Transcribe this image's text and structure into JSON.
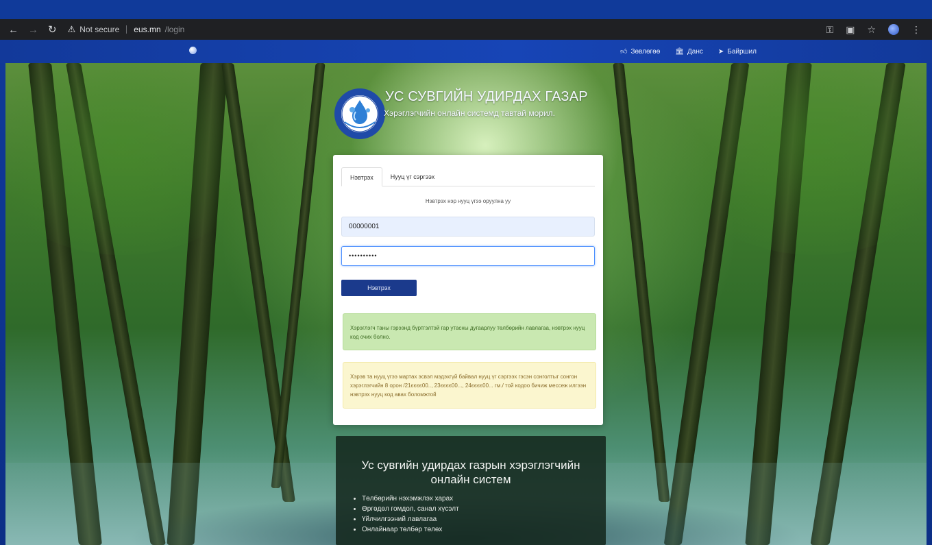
{
  "browser": {
    "security_label": "Not secure",
    "url_host": "eus.mn",
    "url_path": "/login"
  },
  "site_nav": {
    "links": [
      {
        "label": "Зөвлөгөө",
        "icon": "thumbs-up-icon"
      },
      {
        "label": "Данс",
        "icon": "bank-icon"
      },
      {
        "label": "Байршил",
        "icon": "location-arrow-icon"
      }
    ]
  },
  "header": {
    "title": "УС СУВГИЙН УДИРДАХ ГАЗАР",
    "subtitle": "Хэрэглэгчийн онлайн системд тавтай морил.",
    "logo_text_top": "УС СУВГИЙН УДИРДАХ ГАЗАР",
    "logo_text_bottom": "УЛААНБААТАР ХОТ"
  },
  "login": {
    "tabs": [
      "Нэвтрэх",
      "Нууц үг сэргээх"
    ],
    "active_tab": "Нэвтрэх",
    "hint": "Нэвтрэх нэр нууц үгээ оруулна уу",
    "username_value": "00000001",
    "password_value": "••••••••••",
    "submit_label": "Нэвтрэх",
    "info_message": "Хэрэглэгч таны гэрээнд бүртгэлтэй гар утасны дугаарлуу төлбөрийн лавлагаа, нэвтрэх нууц код очих болно.",
    "warning_message": "Хэрэв та нууц үгээ мартах эсвэл мэдэхгүй байвал нууц үг сэргээх гэсэн сонголтыг сонгон хэрэглэгчийн 8 орон /21єєєє00.., 23єєєє00..., 24єєєє00... гм./ той кодоо бичиж мессеж илгээн нэвтрэх нууц код авах боломжтой"
  },
  "info_panel": {
    "title": "Ус сувгийн удирдах газрын хэрэглэгчийн онлайн систем",
    "items": [
      "Төлбөрийн нэхэмжлэх харах",
      "Өргөдөл гомдол, санал хүсэлт",
      "Үйлчилгээний лавлагаа",
      "Онлайнаар төлбөр төлөх"
    ]
  },
  "colors": {
    "nav_blue": "#1745b6",
    "button_navy": "#1b3a8c",
    "alert_green_bg": "#c9e8b1",
    "alert_yellow_bg": "#fbf6cf"
  }
}
